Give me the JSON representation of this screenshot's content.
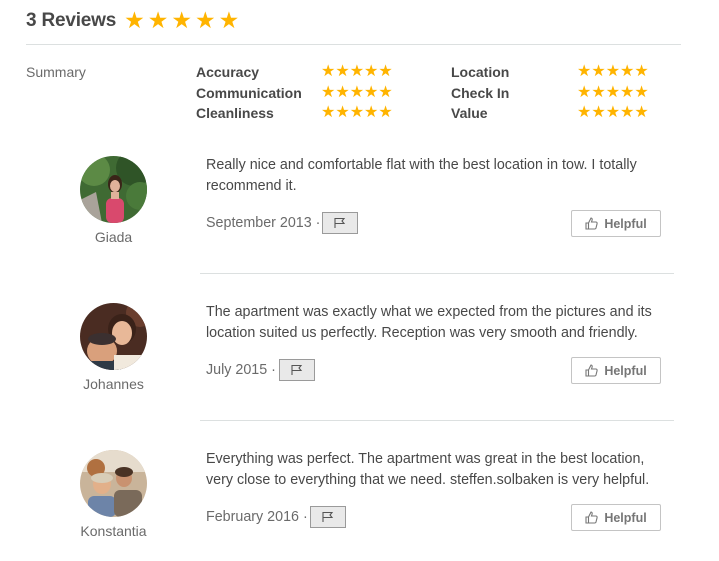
{
  "header": {
    "title": "3 Reviews",
    "rating": 5
  },
  "summary": {
    "label": "Summary",
    "left": [
      {
        "name": "Accuracy",
        "rating": 5
      },
      {
        "name": "Communication",
        "rating": 5
      },
      {
        "name": "Cleanliness",
        "rating": 5
      }
    ],
    "right": [
      {
        "name": "Location",
        "rating": 5
      },
      {
        "name": "Check In",
        "rating": 5
      },
      {
        "name": "Value",
        "rating": 5
      }
    ]
  },
  "reviews": [
    {
      "name": "Giada",
      "text": "Really nice and comfortable flat with the best location in tow. I totally recommend it.",
      "date": "September 2013 ·",
      "helpful_label": "Helpful"
    },
    {
      "name": "Johannes",
      "text": "The apartment was exactly what we expected from the pictures and its location suited us perfectly. Reception was very smooth and friendly.",
      "date": "July 2015 ·",
      "helpful_label": "Helpful"
    },
    {
      "name": "Konstantia",
      "text": "Everything was perfect. The apartment was great in the best location, very close to everything that we need. steffen.solbaken is very helpful.",
      "date": "February 2016 ·",
      "helpful_label": "Helpful"
    }
  ],
  "colors": {
    "star": "#ffb400",
    "text": "#484848",
    "muted": "#6a6a6a",
    "divider": "#dce0e0"
  },
  "icons": {
    "star": "star-icon",
    "flag": "flag-icon",
    "thumbs_up": "thumbs-up-icon"
  }
}
